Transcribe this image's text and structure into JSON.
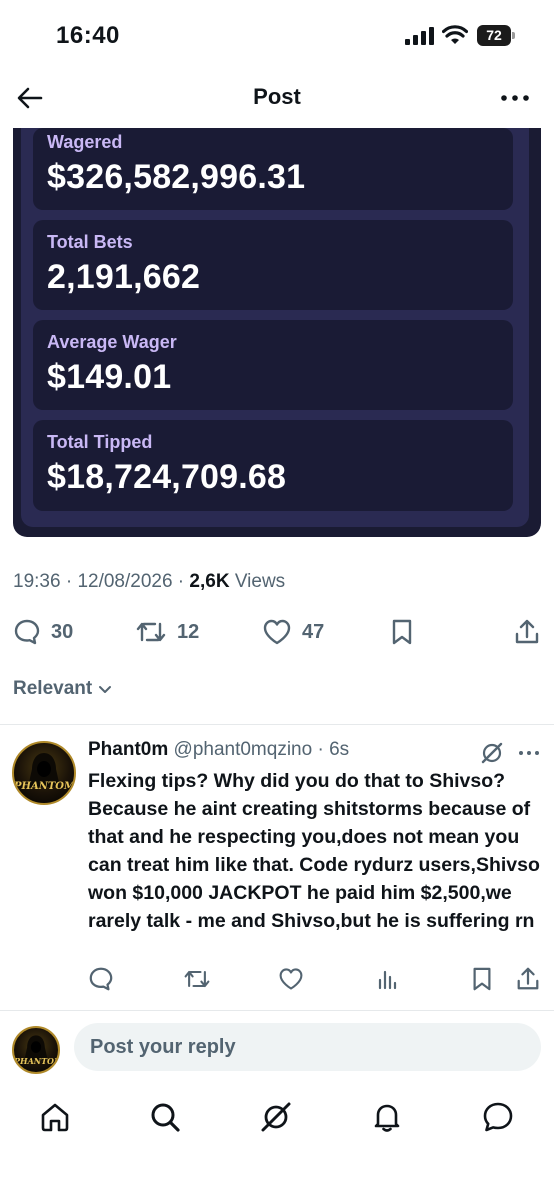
{
  "status_bar": {
    "time": "16:40",
    "battery": "72"
  },
  "header": {
    "title": "Post"
  },
  "stats": [
    {
      "label": "Wagered",
      "value": "$326,582,996.31"
    },
    {
      "label": "Total Bets",
      "value": "2,191,662"
    },
    {
      "label": "Average Wager",
      "value": "$149.01"
    },
    {
      "label": "Total Tipped",
      "value": "$18,724,709.68"
    }
  ],
  "post_meta": {
    "time": "19:36",
    "date": "12/08/2026",
    "views_count": "2,6K",
    "views_label": "Views"
  },
  "actions": {
    "replies": "30",
    "reposts": "12",
    "likes": "47"
  },
  "sort": {
    "label": "Relevant"
  },
  "reply": {
    "name": "Phant0m",
    "handle": "@phant0mqzino",
    "age": "6s",
    "avatar_text": "PHANTOM",
    "text": "Flexing tips? Why did you do that to Shivso? Because he aint creating shitstorms because of that and he respecting you,does not mean you can treat him like that. Code rydurz users,Shivso won $10,000 JACKPOT he paid him $2,500,we rarely talk - me and Shivso,but he is suffering rn"
  },
  "compose": {
    "avatar_text": "PHANTOM",
    "placeholder": "Post your reply"
  },
  "colors": {
    "card_bg": "#1a1b35",
    "card_label": "#c9b8f5",
    "muted": "#536471"
  },
  "icons": [
    "back-arrow-icon",
    "more-icon",
    "reply-icon",
    "repost-icon",
    "like-icon",
    "bookmark-icon",
    "share-icon",
    "chevron-down-icon",
    "grok-icon",
    "analytics-icon",
    "home-icon",
    "search-icon",
    "bell-icon",
    "messages-icon"
  ]
}
